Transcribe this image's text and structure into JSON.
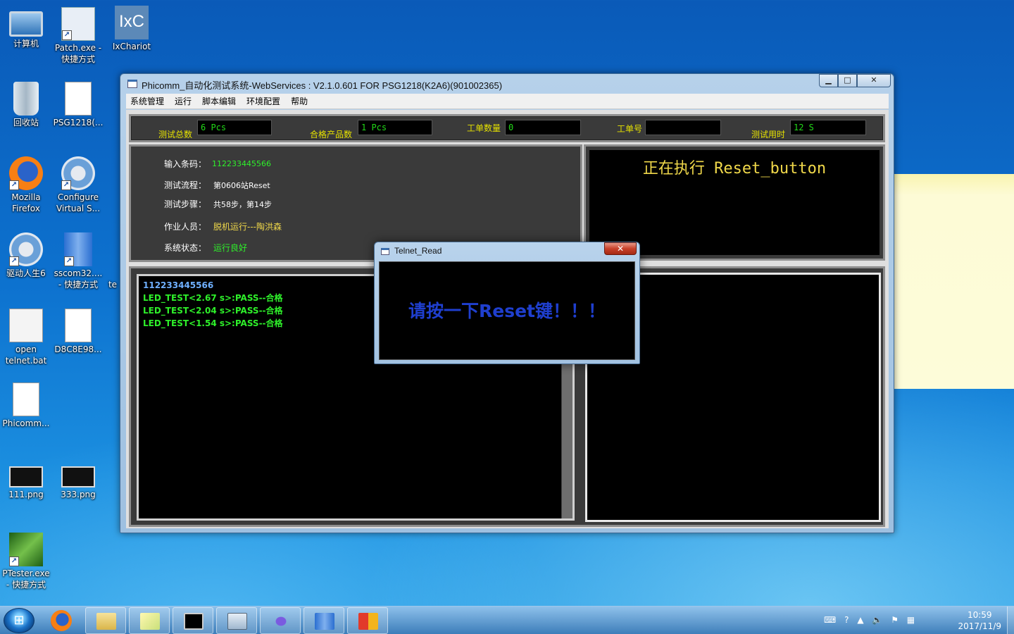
{
  "desktop_icons": [
    {
      "label": "计算机",
      "icon": "computer-icon"
    },
    {
      "label": "Patch.exe - 快捷方式",
      "icon": "patch-shortcut-icon"
    },
    {
      "label": "IxChariot",
      "icon": "ixchariot-icon",
      "icon_text": "IxC"
    },
    {
      "label": "回收站",
      "icon": "recycle-bin-icon"
    },
    {
      "label": "PSG1218(...",
      "icon": "audio-file-icon"
    },
    {
      "label": "Mozilla Firefox",
      "icon": "firefox-icon"
    },
    {
      "label": "Configure Virtual S...",
      "icon": "configure-icon"
    },
    {
      "label": "驱动人生6",
      "icon": "driver-gear-icon"
    },
    {
      "label": "sscom32.... - 快捷方式",
      "icon": "sscom-icon"
    },
    {
      "label": "open telnet.bat",
      "icon": "bat-file-icon"
    },
    {
      "label": "D8C8E98...",
      "icon": "blank-file-icon"
    },
    {
      "label": "Phicomm...",
      "icon": "html-file-icon"
    },
    {
      "label": "111.png",
      "icon": "png-file-icon"
    },
    {
      "label": "333.png",
      "icon": "png-file-icon"
    },
    {
      "label": "PTester.exe - 快捷方式",
      "icon": "ptester-icon"
    }
  ],
  "partial_icon_label": "te",
  "window": {
    "title": "Phicomm_自动化测试系统-WebServices : V2.1.0.601 FOR  PSG1218(K2A6)(901002365)",
    "minimize": "▁",
    "maximize": "□",
    "close": "✕",
    "menu": [
      "系统管理",
      "运行",
      "脚本编辑",
      "环境配置",
      "帮助"
    ]
  },
  "stats": {
    "total_label": "测试总数",
    "total_value": "6 Pcs",
    "pass_label": "合格产品数",
    "pass_value": "1 Pcs",
    "order_qty_label": "工单数量",
    "order_qty_value": "0",
    "order_no_label": "工单号",
    "order_no_value": "",
    "time_label": "测试用时",
    "time_value": "12 S"
  },
  "info": {
    "barcode_label": "输入条码：",
    "barcode_value": "112233445566",
    "flow_label": "测试流程：",
    "flow_value": "第0606站Reset",
    "step_label": "测试步骤：",
    "step_value": "共58步，第14步",
    "operator_label": "作业人员：",
    "operator_value": "脱机运行---陶洪森",
    "status_label": "系统状态：",
    "status_value": "运行良好"
  },
  "executing": "正在执行 Reset_button",
  "log": {
    "barcode": "112233445566",
    "lines": [
      "LED_TEST<2.67 s>:PASS--合格",
      "LED_TEST<2.04 s>:PASS--合格",
      "LED_TEST<1.54 s>:PASS--合格"
    ]
  },
  "dialog": {
    "title": "Telnet_Read",
    "close": "✕",
    "message": "请按一下Reset键！！！"
  },
  "taskbar": {
    "start_glyph": "⊞",
    "clock_time": "10:59",
    "clock_date": "2017/11/9"
  },
  "colors": {
    "stat_label": "#e6e200",
    "stat_value": "#22d818",
    "log_pass": "#2ef02a",
    "log_barcode": "#6fb0ff",
    "dialog_message": "#1f3fcf",
    "executing_text": "#f0d84a"
  }
}
